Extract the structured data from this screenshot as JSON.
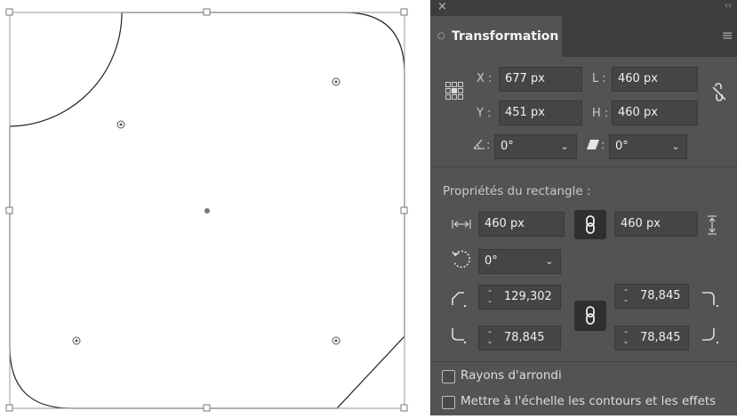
{
  "panel": {
    "close_glyph": "×",
    "collapse_glyph": "‹‹",
    "tab_dot": "○",
    "tab_title": "Transformation",
    "menu_glyph": "≡",
    "x_label": "X :",
    "x_value": "677 px",
    "y_label": "Y :",
    "y_value": "451 px",
    "l_label": "L :",
    "l_value": "460 px",
    "h_label": "H :",
    "h_value": "460 px",
    "angle_value": "0°",
    "shear_value": "0°",
    "angle_sep": ":",
    "shear_sep": ":",
    "rect_section_label": "Propriétés du rectangle :",
    "rect_width_value": "460 px",
    "rect_height_value": "460 px",
    "rotation_value": "0°",
    "corner_tl_value": "129,302",
    "corner_tr_value": "78,845",
    "corner_bl_value": "78,845",
    "corner_br_value": "78,845",
    "checkbox_rounded_label": "Rayons d'arrondi",
    "checkbox_scale_label": "Mettre à l'échelle les contours et les effets"
  },
  "colors": {
    "panel_bg": "#535353",
    "field_bg": "#454545",
    "header_bg": "#3d3d3d"
  }
}
